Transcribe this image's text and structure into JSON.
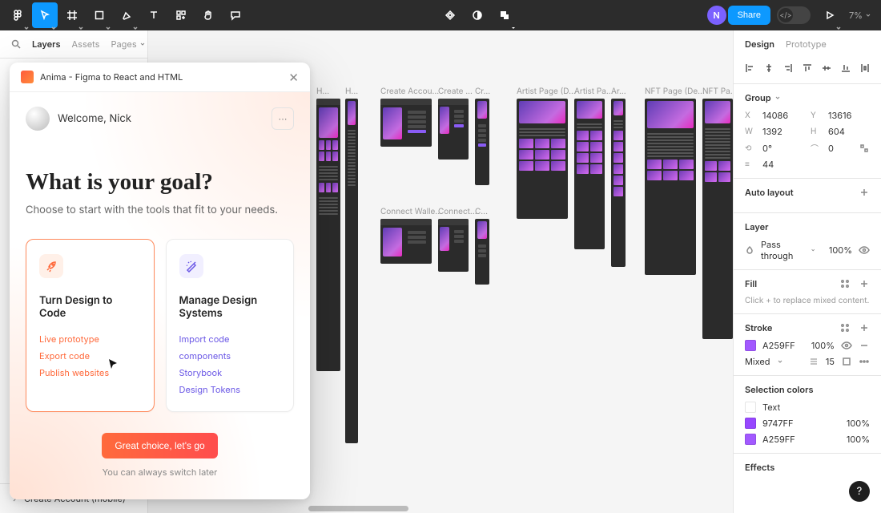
{
  "topbar": {
    "avatar_letter": "N",
    "share_label": "Share",
    "zoom": "7%"
  },
  "leftpanel": {
    "tab_layers": "Layers",
    "tab_assets": "Assets",
    "pages_label": "Pages",
    "search_icon": "search-icon",
    "bottom_item": "Create Account (mobile)"
  },
  "rightpanel": {
    "tab_design": "Design",
    "tab_prototype": "Prototype",
    "group": {
      "title": "Group",
      "x_label": "X",
      "x": "14086",
      "y_label": "Y",
      "y": "13616",
      "w_label": "W",
      "w": "1392",
      "h_label": "H",
      "h": "604",
      "rot_label": "⟳",
      "rot": "0°",
      "corner_label": "⌒",
      "corner": "0",
      "gap_label": "≡",
      "gap": "44"
    },
    "autolayout": {
      "title": "Auto layout"
    },
    "layer": {
      "title": "Layer",
      "blend_mode": "Pass through",
      "opacity": "100%"
    },
    "fill": {
      "title": "Fill",
      "hint": "Click + to replace mixed content."
    },
    "stroke": {
      "title": "Stroke",
      "hex": "A259FF",
      "opacity": "100%",
      "style": "Mixed",
      "weight": "15"
    },
    "selection": {
      "title": "Selection colors",
      "items": [
        {
          "name": "Text",
          "swatch": "#ffffff",
          "opacity": ""
        },
        {
          "name": "9747FF",
          "swatch": "#9747FF",
          "opacity": "100%"
        },
        {
          "name": "A259FF",
          "swatch": "#A259FF",
          "opacity": "100%"
        }
      ]
    },
    "effects": {
      "title": "Effects"
    }
  },
  "canvas": {
    "groups": [
      {
        "label": "H...",
        "label2": "H..."
      },
      {
        "label": "Create Accou...",
        "label2": "Create ...",
        "label3": "Cr..."
      },
      {
        "label": "Artist Page (D...",
        "label2": "Artist Pa...",
        "label3": "Ar..."
      },
      {
        "label": "NFT Page (De...",
        "label2": "NFT Pa..."
      },
      {
        "label": "Connect Walle...",
        "label2": "Connect...",
        "label3": "C..."
      }
    ]
  },
  "plugin": {
    "title": "Anima - Figma to React and HTML",
    "welcome": "Welcome, Nick",
    "headline": "What is your goal?",
    "sub": "Choose to start with the tools that fit to your needs.",
    "card1": {
      "title": "Turn Design to Code",
      "links": [
        "Live prototype",
        "Export code",
        "Publish websites"
      ]
    },
    "card2": {
      "title": "Manage Design Systems",
      "links": [
        "Import code components",
        "Storybook",
        "Design Tokens"
      ]
    },
    "cta": "Great choice, let's go",
    "hint": "You can always switch later"
  },
  "help": {
    "label": "?"
  }
}
